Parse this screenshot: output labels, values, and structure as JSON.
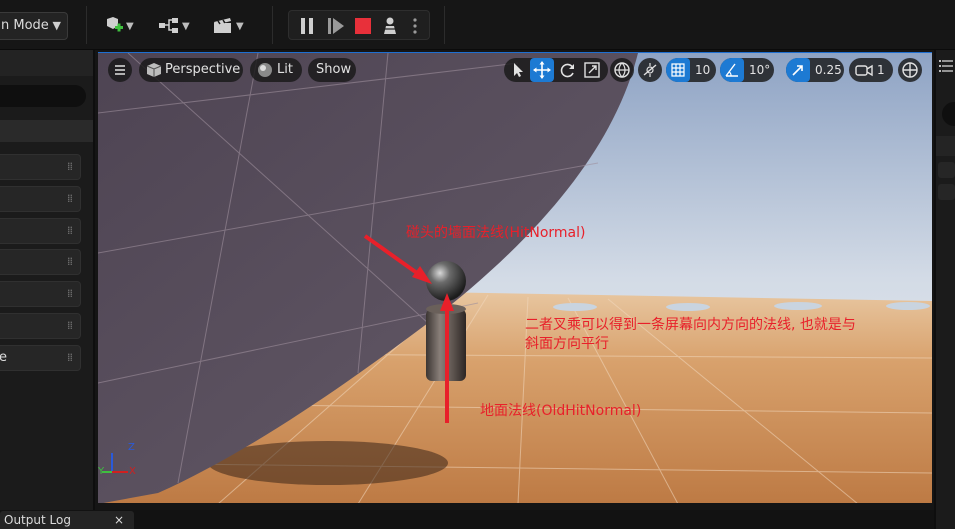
{
  "toolbar": {
    "mode_label": "n Mode",
    "chevron": "⌄",
    "icons": [
      "add-actor-icon",
      "blueprint-icon",
      "cinematics-icon"
    ]
  },
  "play_controls": {
    "icons": [
      "pause-icon",
      "step-frame-icon",
      "stop-icon",
      "possess-icon",
      "more-options-icon"
    ]
  },
  "left_panel": {
    "rows": [
      "",
      "",
      "",
      "",
      "",
      "",
      "e"
    ]
  },
  "viewport": {
    "view_mode": "Perspective",
    "lighting_mode": "Lit",
    "show_label": "Show",
    "grid_snap": "10",
    "rotation_snap": "10°",
    "scale_snap": "0.25",
    "camera_speed": "1",
    "axis_labels": {
      "z": "Z",
      "x": "X",
      "y": "Y"
    }
  },
  "annotations": {
    "wall_normal": "碰头的墙面法线(HitNormal)",
    "cross_product_line1": "二者叉乘可以得到一条屏幕向内方向的法线, 也就是与",
    "cross_product_line2": "斜面方向平行",
    "floor_normal": "地面法线(OldHitNormal)"
  },
  "bottom": {
    "output_log_tab": "Output Log",
    "close_glyph": "×"
  },
  "colors": {
    "accent_blue": "#1d7ad3",
    "annotation_red": "#e8202a",
    "stop_red": "#e8303a"
  }
}
